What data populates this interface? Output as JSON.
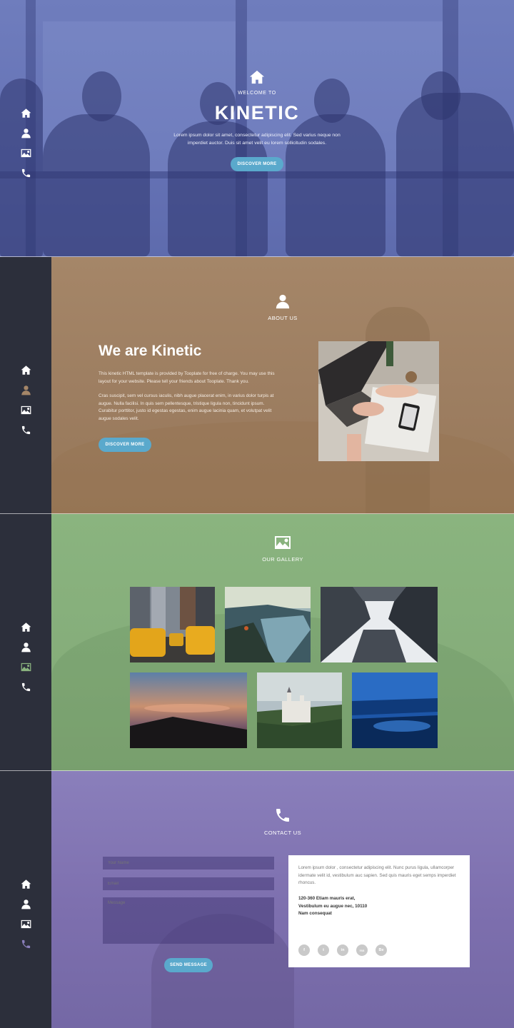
{
  "hero": {
    "welcome": "WELCOME TO",
    "title": "KINETIC",
    "text": "Lorem ipsum dolor sit amet, consectetur adipiscing elit. Sed varius neque non imperdiet auctor. Duis sit amet velit eu lorem sollicitudin sodales.",
    "button": "DISCOVER MORE"
  },
  "about": {
    "label": "ABOUT US",
    "heading": "We are Kinetic",
    "p1": "This kinetic HTML template is provided by Tooplate for free of charge. You may use this layout for your website. Please tell your friends about Tooplate. Thank you.",
    "p2": "Cras suscipit, sem vel cursus iaculis, nibh augue placerat enim, in varius dolor turpis at augue. Nulla facilisi. In quis sem pellentesque, tristique ligula non, tincidunt ipsum. Curabitur porttitor, justo id egestas egestas, enim augue lacinia quam, et volutpat velit augue sodales velit.",
    "button": "DISCOVER MORE"
  },
  "gallery": {
    "label": "OUR GALLERY"
  },
  "contact": {
    "label": "CONTACT US",
    "name_placeholder": "Your Name",
    "email_placeholder": "Email",
    "message_placeholder": "Message",
    "button": "SEND MESSAGE",
    "card_text": "Lorem ipsum dolor , consectetur adipiscing elit. Nunc purus ligula, ullamcorper idermate velit id, vestibulum auc sapien. Sed quis mauris eget semps imperdiet rhoncus.",
    "address_line1": "120-360 Etiam mauris erat,",
    "address_line2": "Vestibulum eu augue nec, 10110",
    "address_line3": "Nam consequat",
    "social": [
      "f",
      "t",
      "in",
      "rss",
      "Be"
    ]
  },
  "nav": {
    "items": [
      "home-icon",
      "user-icon",
      "image-icon",
      "phone-icon"
    ]
  },
  "colors": {
    "hero": "#6673b6",
    "about": "#9c7d60",
    "gallery": "#85ad7a",
    "contact": "#7d6fae",
    "sidebar": "#2c2f3b",
    "button": "#5aa9cc",
    "about_active": "#a58668",
    "gallery_active": "#8ab47f",
    "contact_active": "#8a7fbb"
  }
}
